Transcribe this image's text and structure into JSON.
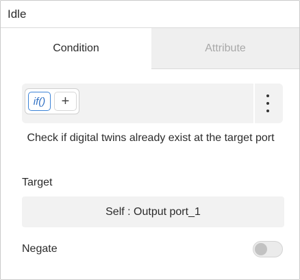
{
  "header": {
    "title": "Idle"
  },
  "tabs": [
    {
      "label": "Condition",
      "active": true
    },
    {
      "label": "Attribute",
      "active": false
    }
  ],
  "toolbar": {
    "if_label": "if()",
    "add_label": "+"
  },
  "description": "Check if digital twins already exist at the target port",
  "target": {
    "label": "Target",
    "value": "Self : Output port_1"
  },
  "negate": {
    "label": "Negate",
    "enabled": false
  },
  "colors": {
    "accent": "#3b82d6",
    "inactive_tab_bg": "#efefef",
    "field_bg": "#f2f2f2"
  }
}
